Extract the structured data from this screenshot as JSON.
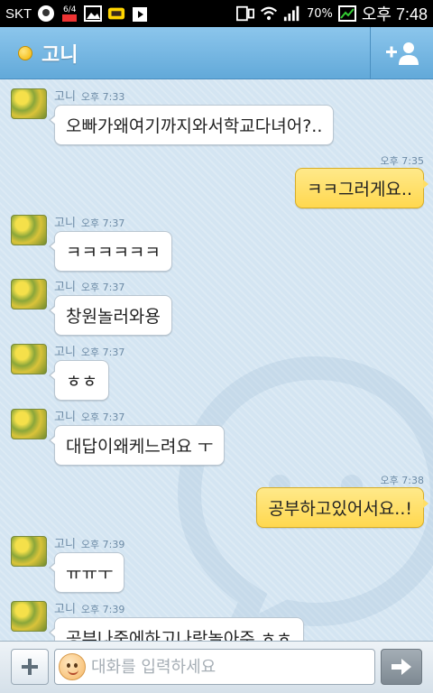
{
  "status_bar": {
    "carrier": "SKT",
    "battery_label": "70%",
    "time": "오후 7:48",
    "notif_badge_label": "6/4"
  },
  "header": {
    "title": "고니",
    "add_friend_icon": "add-person-icon"
  },
  "messages": [
    {
      "dir": "in",
      "sender": "고니",
      "time": "오후 7:33",
      "text": "오빠가왜여기까지와서학교다녀어?.."
    },
    {
      "dir": "out",
      "time": "오후 7:35",
      "text": "ㅋㅋ그러게요.."
    },
    {
      "dir": "in",
      "sender": "고니",
      "time": "오후 7:37",
      "text": "ㅋㅋㅋㅋㅋㅋ"
    },
    {
      "dir": "in",
      "sender": "고니",
      "time": "오후 7:37",
      "text": "창원놀러와용"
    },
    {
      "dir": "in",
      "sender": "고니",
      "time": "오후 7:37",
      "text": "ㅎㅎ"
    },
    {
      "dir": "in",
      "sender": "고니",
      "time": "오후 7:37",
      "text": "대답이왜케느려요 ㅜ"
    },
    {
      "dir": "out",
      "time": "오후 7:38",
      "text": "공부하고있어서요..!"
    },
    {
      "dir": "in",
      "sender": "고니",
      "time": "오후 7:39",
      "text": "ㅠㅠㅜ"
    },
    {
      "dir": "in",
      "sender": "고니",
      "time": "오후 7:39",
      "text": "공부나중에하고나랑놀아주 ㅎㅎ"
    }
  ],
  "input": {
    "placeholder": "대화를 입력하세요",
    "value": ""
  },
  "colors": {
    "header": "#6fb2e0",
    "bubble_out": "#ffdf66",
    "bubble_in": "#ffffff",
    "chat_bg": "#d4e5f2"
  }
}
